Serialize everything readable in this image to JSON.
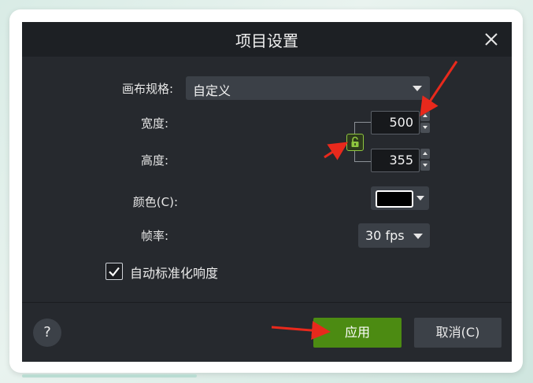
{
  "dialog": {
    "title": "项目设置",
    "canvas_size_label": "画布规格:",
    "canvas_size_value": "自定义",
    "width_label": "宽度:",
    "width_value": "500",
    "height_label": "高度:",
    "height_value": "355",
    "color_label": "颜色(C):",
    "color_value": "#000000",
    "framerate_label": "帧率:",
    "framerate_value": "30 fps",
    "auto_normalize_label": "自动标准化响度",
    "auto_normalize_checked": true,
    "help_label": "?",
    "apply_label": "应用",
    "cancel_label": "取消(C)"
  },
  "colors": {
    "dialog_bg": "#26292e",
    "titlebar_bg": "#1d2024",
    "apply_green": "#4c8b12",
    "lock_green": "#8ec63f",
    "annotation_red": "#e8291c"
  },
  "icons": [
    "close-icon",
    "lock-icon",
    "check-icon",
    "caret-down-icon",
    "spin-up-icon",
    "spin-down-icon"
  ]
}
